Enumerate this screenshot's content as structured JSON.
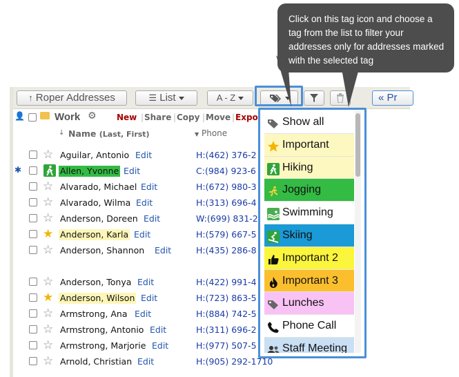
{
  "tooltip": {
    "text": "Click on this tag icon and choose a tag from the list to filter your addresses only for addresses marked with the selected tag"
  },
  "toolbar": {
    "roper_label": "Roper Addresses",
    "list_label": "List",
    "sort_label": "A - Z",
    "prev_label": "Pr"
  },
  "folder": {
    "name": "Work",
    "actions": [
      "New",
      "Share",
      "Copy",
      "Move",
      "Expor"
    ]
  },
  "columns": {
    "name_header": "Name",
    "name_sub": "(Last, First)",
    "phone_header": "Phone"
  },
  "contacts": [
    {
      "name": "Aguilar, Antonio",
      "phone": "H:(462) 376-2",
      "star": false,
      "highlight": "none",
      "shared": false
    },
    {
      "name": "Allen, Yvonne",
      "phone": "C:(984) 923-6",
      "star": false,
      "highlight": "green",
      "shared": true,
      "tag_icon": "hiking-icon"
    },
    {
      "name": "Alvarado, Michael",
      "phone": "H:(672) 980-3",
      "star": false,
      "highlight": "none",
      "shared": false
    },
    {
      "name": "Alvarado, Wilma",
      "phone": "H:(313) 696-4",
      "star": false,
      "highlight": "none",
      "shared": false
    },
    {
      "name": "Anderson, Doreen",
      "phone": "W:(699) 831-2",
      "star": false,
      "highlight": "none",
      "shared": false
    },
    {
      "name": "Anderson, Karla",
      "phone": "H:(579) 667-5",
      "star": true,
      "highlight": "yellow",
      "shared": false
    },
    {
      "name": "Anderson, Shannon",
      "phone": "H:(435) 286-8",
      "star": false,
      "highlight": "none",
      "shared": false
    },
    {
      "name": "Anderson, Tonya",
      "phone": "H:(422) 991-4",
      "star": false,
      "highlight": "none",
      "shared": false
    },
    {
      "name": "Anderson, Wilson",
      "phone": "H:(723) 863-5",
      "star": true,
      "highlight": "yellow",
      "shared": false
    },
    {
      "name": "Armstrong, Ana",
      "phone": "H:(884) 742-5",
      "star": false,
      "highlight": "none",
      "shared": false
    },
    {
      "name": "Armstrong, Antonio",
      "phone": "H:(311) 696-2",
      "star": false,
      "highlight": "none",
      "shared": false
    },
    {
      "name": "Armstrong, Marjorie",
      "phone": "H:(977) 507-5",
      "star": false,
      "highlight": "none",
      "shared": false
    },
    {
      "name": "Arnold, Christian",
      "phone": "H:(905) 292-1710",
      "star": false,
      "highlight": "none",
      "shared": false
    }
  ],
  "edit_label": "Edit",
  "tag_menu": [
    {
      "label": "Show all",
      "bg": "#ffffff",
      "icon": "tag-icon"
    },
    {
      "label": "Important",
      "bg": "#fdf7c0",
      "icon": "star-icon"
    },
    {
      "label": "Hiking",
      "bg": "#fdf7c0",
      "icon": "hiking-icon"
    },
    {
      "label": "Jogging",
      "bg": "#33bb44",
      "icon": "jogging-icon"
    },
    {
      "label": "Swimming",
      "bg": "#ffffff",
      "icon": "swimming-icon"
    },
    {
      "label": "Skiing",
      "bg": "#1a9ad6",
      "icon": "skiing-icon"
    },
    {
      "label": "Important 2",
      "bg": "#fbf53c",
      "icon": "thumbs-up-icon"
    },
    {
      "label": "Important 3",
      "bg": "#fbbf2e",
      "icon": "fire-icon"
    },
    {
      "label": "Lunches",
      "bg": "#f9c2f5",
      "icon": "tag-icon"
    },
    {
      "label": "Phone Call",
      "bg": "#ffffff",
      "icon": "phone-icon"
    },
    {
      "label": "Staff Meeting",
      "bg": "#c9dff3",
      "icon": "people-icon"
    }
  ],
  "colors": {
    "highlight_blue": "#4a8fd8",
    "tooltip_bg": "#4d4d4d",
    "new_red": "#a50000",
    "link_blue": "#2255aa"
  }
}
